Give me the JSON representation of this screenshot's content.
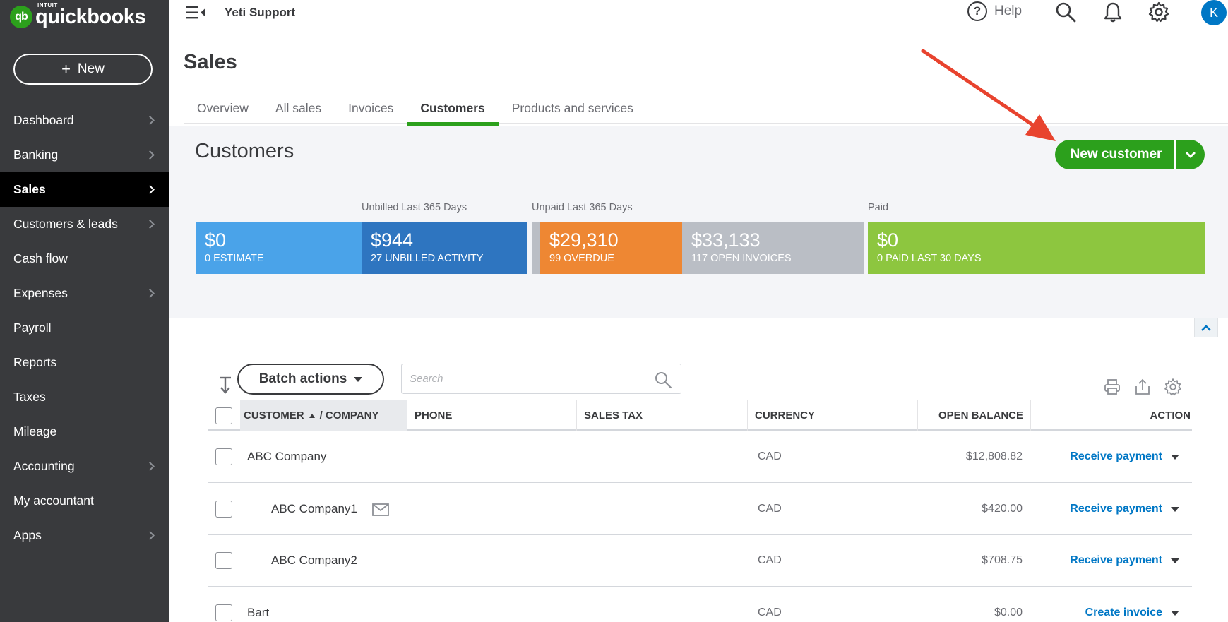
{
  "app": {
    "logo_brand": "quickbooks",
    "logo_parent": "INTUIT",
    "logo_badge": "qb"
  },
  "sidebar": {
    "new_label": "New",
    "items": [
      {
        "label": "Dashboard",
        "chevron": true
      },
      {
        "label": "Banking",
        "chevron": true
      },
      {
        "label": "Sales",
        "chevron": true,
        "active": true
      },
      {
        "label": "Customers & leads",
        "chevron": true
      },
      {
        "label": "Cash flow",
        "chevron": false
      },
      {
        "label": "Expenses",
        "chevron": true
      },
      {
        "label": "Payroll",
        "chevron": false
      },
      {
        "label": "Reports",
        "chevron": false
      },
      {
        "label": "Taxes",
        "chevron": false
      },
      {
        "label": "Mileage",
        "chevron": false
      },
      {
        "label": "Accounting",
        "chevron": true
      },
      {
        "label": "My accountant",
        "chevron": false
      },
      {
        "label": "Apps",
        "chevron": true
      }
    ]
  },
  "topbar": {
    "company": "Yeti Support",
    "help_label": "Help",
    "avatar_initial": "K"
  },
  "page": {
    "title": "Sales"
  },
  "tabs": [
    {
      "label": "Overview"
    },
    {
      "label": "All sales"
    },
    {
      "label": "Invoices"
    },
    {
      "label": "Customers",
      "active": true
    },
    {
      "label": "Products and services"
    }
  ],
  "customers": {
    "title": "Customers",
    "new_customer_label": "New customer",
    "band_labels": {
      "unbilled": "Unbilled Last 365 Days",
      "unpaid": "Unpaid Last 365 Days",
      "paid": "Paid"
    },
    "money_bar": [
      {
        "amount": "$0",
        "caption": "0 ESTIMATE",
        "color": "#4aa3e9"
      },
      {
        "amount": "$944",
        "caption": "27 UNBILLED ACTIVITY",
        "color": "#2e75c0"
      },
      {
        "amount": "$29,310",
        "caption": "99 OVERDUE",
        "color": "#ee8733"
      },
      {
        "amount": "$33,133",
        "caption": "117 OPEN INVOICES",
        "color": "#babec5"
      },
      {
        "amount": "$0",
        "caption": "0 PAID LAST 30 DAYS",
        "color": "#8dc63f"
      }
    ]
  },
  "toolbar": {
    "batch_actions_label": "Batch actions",
    "search_placeholder": "Search"
  },
  "table": {
    "headers": {
      "customer": "CUSTOMER",
      "company": "/ COMPANY",
      "phone": "PHONE",
      "sales_tax": "SALES TAX",
      "currency": "CURRENCY",
      "open_balance": "OPEN BALANCE",
      "action": "ACTION"
    },
    "rows": [
      {
        "name": "ABC Company",
        "indent": false,
        "email": false,
        "currency": "CAD",
        "balance": "$12,808.82",
        "action": "Receive payment"
      },
      {
        "name": "ABC Company1",
        "indent": true,
        "email": true,
        "currency": "CAD",
        "balance": "$420.00",
        "action": "Receive payment"
      },
      {
        "name": "ABC Company2",
        "indent": true,
        "email": false,
        "currency": "CAD",
        "balance": "$708.75",
        "action": "Receive payment"
      },
      {
        "name": "Bart",
        "indent": false,
        "email": false,
        "currency": "CAD",
        "balance": "$0.00",
        "action": "Create invoice"
      }
    ]
  },
  "colors": {
    "brand_green": "#2ca01c",
    "link_blue": "#0077c5",
    "sidebar_bg": "#393a3d",
    "annotation_arrow": "#e8432e"
  }
}
